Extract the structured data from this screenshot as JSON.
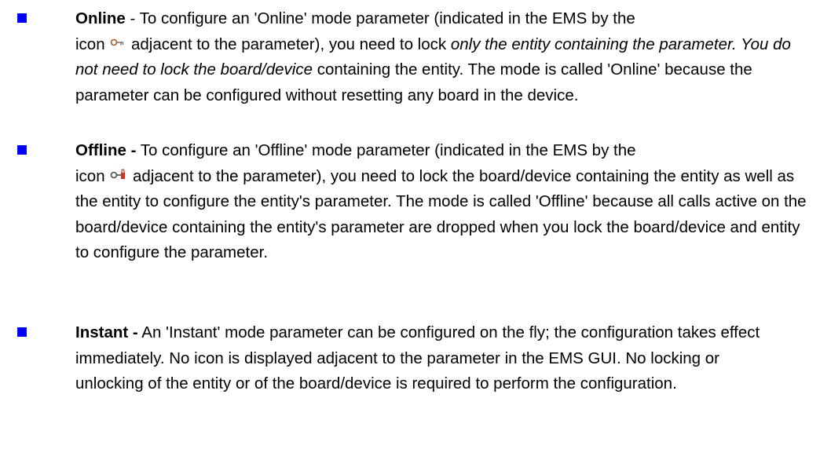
{
  "items": [
    {
      "term": "Online",
      "sep": " - ",
      "line1": "To configure an 'Online' mode parameter (indicated in the EMS by the",
      "icon_prefix": "icon ",
      "icon_name": "online-key-icon",
      "after_icon": " adjacent to the parameter), you need to lock ",
      "em1": "only the entity containing the parameter. You do not need to lock the board/device",
      "rest": " containing the entity. The mode is called 'Online' because the parameter can be configured without resetting any board in the device."
    },
    {
      "term": "Offline -",
      "line1": " To configure an 'Offline' mode parameter (indicated in the EMS by the",
      "icon_prefix": "icon ",
      "icon_name": "offline-key-lock-icon",
      "rest": " adjacent to the parameter), you need to lock the board/device containing the entity as well as the entity to configure the entity's parameter. The mode is called 'Offline' because all calls active on the board/device containing the entity's parameter are dropped when you lock the board/device and entity to configure the parameter."
    },
    {
      "term": "Instant -",
      "rest": " An 'Instant' mode parameter can be configured on the fly; the configuration takes effect immediately. No icon is displayed adjacent to the parameter in the EMS GUI. No locking or unlocking of the entity or of the board/device is required to perform the configuration."
    }
  ],
  "colors": {
    "bullet": "#0000ff",
    "text": "#000000"
  }
}
